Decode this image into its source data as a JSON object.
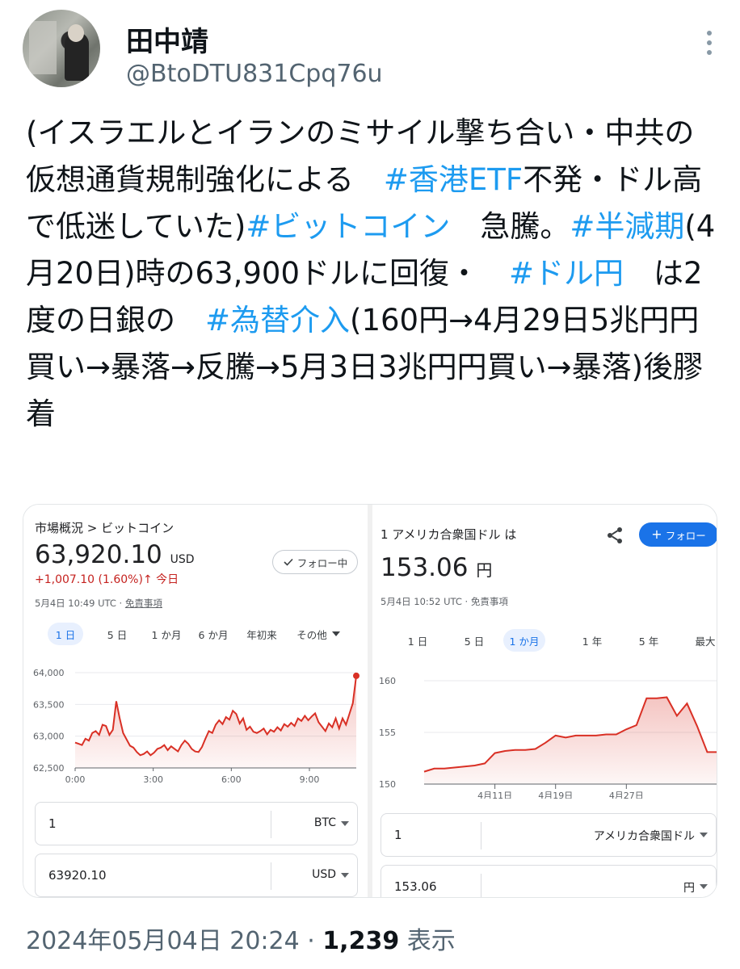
{
  "author": {
    "name": "田中靖",
    "handle": "@BtoDTU831Cpq76u"
  },
  "tweet": {
    "segments": [
      {
        "text": "(イスラエルとイランのミサイル撃ち合い・中共の仮想通貨規制強化による　",
        "tag": false
      },
      {
        "text": "#香港ETF",
        "tag": true
      },
      {
        "text": "不発・ドル高で低迷していた)",
        "tag": false
      },
      {
        "text": "#ビットコイン",
        "tag": true
      },
      {
        "text": "　急騰。",
        "tag": false
      },
      {
        "text": "#半減期",
        "tag": true
      },
      {
        "text": "(4月20日)時の63,900ドルに回復・　",
        "tag": false
      },
      {
        "text": "#ドル円",
        "tag": true
      },
      {
        "text": "　は2度の日銀の　",
        "tag": false
      },
      {
        "text": "#為替介入",
        "tag": true
      },
      {
        "text": "(160円→4月29日5兆円円買い→暴落→反騰→5月3日3兆円円買い→暴落)後膠着",
        "tag": false
      }
    ]
  },
  "btc_card": {
    "breadcrumb": "市場概況 > ビットコイン",
    "price": "63,920.10",
    "currency": "USD",
    "change": "+1,007.10 (1.60%)",
    "change_arrow": "↑",
    "change_period": "今日",
    "timestamp": "5月4日 10:49 UTC · ",
    "disclaimer": "免責事項",
    "follow_label": "フォロー中",
    "tabs": [
      "1 日",
      "5 日",
      "1 か月",
      "6 か月",
      "年初来",
      "その他"
    ],
    "active_tab": 0,
    "converter": [
      {
        "value": "1",
        "unit": "BTC"
      },
      {
        "value": "63920.10",
        "unit": "USD"
      }
    ]
  },
  "usd_card": {
    "title": "1 アメリカ合衆国ドル は",
    "price": "153.06",
    "currency": "円",
    "timestamp": "5月4日 10:52 UTC · 免責事項",
    "follow_label": "フォロー",
    "tabs": [
      "1 日",
      "5 日",
      "1 か月",
      "1 年",
      "5 年",
      "最大"
    ],
    "active_tab": 2,
    "converter": [
      {
        "value": "1",
        "unit": "アメリカ合衆国ドル"
      },
      {
        "value": "153.06",
        "unit": "円"
      }
    ]
  },
  "footer": {
    "datetime": "2024年05月04日 20:24",
    "dot": " · ",
    "views": "1,239",
    "views_label": " 表示"
  },
  "colors": {
    "link": "#1d9bf0",
    "down_red": "#c5221f",
    "chart_red": "#d93025",
    "google_blue": "#1a73e8"
  },
  "chart_data": [
    {
      "type": "area",
      "series": [
        {
          "values": [
            62900,
            62880,
            62860,
            62960,
            62930,
            63050,
            63080,
            63020,
            63180,
            63160,
            63020,
            63100,
            63550,
            63280,
            63050,
            62950,
            62850,
            62820,
            62750,
            62700,
            62720,
            62760,
            62700,
            62740,
            62800,
            62820,
            62860,
            62780,
            62840,
            62800,
            62760,
            62860,
            62930,
            62880,
            62800,
            62760,
            62750,
            62830,
            62960,
            63080,
            63050,
            63180,
            63250,
            63190,
            63300,
            63260,
            63400,
            63350,
            63200,
            63280,
            63100,
            63150,
            63070,
            63050,
            63080,
            63120,
            63030,
            63100,
            63070,
            63140,
            63090,
            63190,
            63150,
            63210,
            63160,
            63280,
            63240,
            63320,
            63250,
            63310,
            63360,
            63220,
            63150,
            63080,
            63200,
            63140,
            63280,
            63120,
            63280,
            63180,
            63350,
            63520,
            63950
          ]
        }
      ],
      "x_range": [
        0,
        10.8
      ],
      "xticks": [
        "0:00",
        "3:00",
        "6:00",
        "9:00"
      ],
      "xtick_values": [
        0,
        3,
        6,
        9
      ],
      "yticks": [
        "62,500",
        "63,000",
        "63,500",
        "64,000"
      ],
      "ytick_values": [
        62500,
        63000,
        63500,
        64000
      ],
      "ylim": [
        62500,
        64000
      ]
    },
    {
      "type": "area",
      "series": [
        {
          "values": [
            151.2,
            151.5,
            151.5,
            151.6,
            151.7,
            151.8,
            152.0,
            153.0,
            153.2,
            153.3,
            153.3,
            153.4,
            154.0,
            154.7,
            154.5,
            154.7,
            154.7,
            154.7,
            154.8,
            154.8,
            155.3,
            155.7,
            158.3,
            158.3,
            158.4,
            156.6,
            157.8,
            155.6,
            153.1,
            153.1,
            153.1,
            153.06
          ]
        }
      ],
      "xticks": [
        "4月11日",
        "4月19日",
        "4月27日"
      ],
      "xtick_indices": [
        7,
        13,
        20
      ],
      "yticks": [
        "150",
        "155",
        "160"
      ],
      "ytick_values": [
        150,
        155,
        160
      ],
      "ylim": [
        150,
        160
      ]
    }
  ]
}
